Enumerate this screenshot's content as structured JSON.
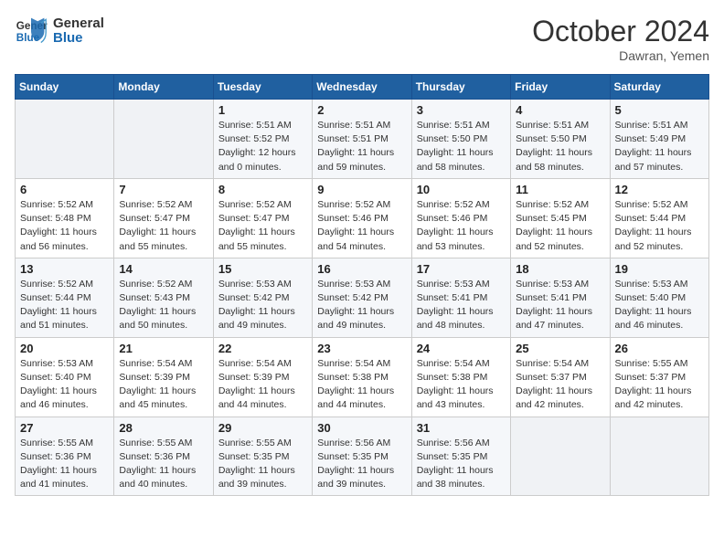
{
  "logo": {
    "line1": "General",
    "line2": "Blue"
  },
  "header": {
    "month": "October 2024",
    "location": "Dawran, Yemen"
  },
  "days_of_week": [
    "Sunday",
    "Monday",
    "Tuesday",
    "Wednesday",
    "Thursday",
    "Friday",
    "Saturday"
  ],
  "weeks": [
    [
      {
        "day": "",
        "detail": ""
      },
      {
        "day": "",
        "detail": ""
      },
      {
        "day": "1",
        "detail": "Sunrise: 5:51 AM\nSunset: 5:52 PM\nDaylight: 12 hours\nand 0 minutes."
      },
      {
        "day": "2",
        "detail": "Sunrise: 5:51 AM\nSunset: 5:51 PM\nDaylight: 11 hours\nand 59 minutes."
      },
      {
        "day": "3",
        "detail": "Sunrise: 5:51 AM\nSunset: 5:50 PM\nDaylight: 11 hours\nand 58 minutes."
      },
      {
        "day": "4",
        "detail": "Sunrise: 5:51 AM\nSunset: 5:50 PM\nDaylight: 11 hours\nand 58 minutes."
      },
      {
        "day": "5",
        "detail": "Sunrise: 5:51 AM\nSunset: 5:49 PM\nDaylight: 11 hours\nand 57 minutes."
      }
    ],
    [
      {
        "day": "6",
        "detail": "Sunrise: 5:52 AM\nSunset: 5:48 PM\nDaylight: 11 hours\nand 56 minutes."
      },
      {
        "day": "7",
        "detail": "Sunrise: 5:52 AM\nSunset: 5:47 PM\nDaylight: 11 hours\nand 55 minutes."
      },
      {
        "day": "8",
        "detail": "Sunrise: 5:52 AM\nSunset: 5:47 PM\nDaylight: 11 hours\nand 55 minutes."
      },
      {
        "day": "9",
        "detail": "Sunrise: 5:52 AM\nSunset: 5:46 PM\nDaylight: 11 hours\nand 54 minutes."
      },
      {
        "day": "10",
        "detail": "Sunrise: 5:52 AM\nSunset: 5:46 PM\nDaylight: 11 hours\nand 53 minutes."
      },
      {
        "day": "11",
        "detail": "Sunrise: 5:52 AM\nSunset: 5:45 PM\nDaylight: 11 hours\nand 52 minutes."
      },
      {
        "day": "12",
        "detail": "Sunrise: 5:52 AM\nSunset: 5:44 PM\nDaylight: 11 hours\nand 52 minutes."
      }
    ],
    [
      {
        "day": "13",
        "detail": "Sunrise: 5:52 AM\nSunset: 5:44 PM\nDaylight: 11 hours\nand 51 minutes."
      },
      {
        "day": "14",
        "detail": "Sunrise: 5:52 AM\nSunset: 5:43 PM\nDaylight: 11 hours\nand 50 minutes."
      },
      {
        "day": "15",
        "detail": "Sunrise: 5:53 AM\nSunset: 5:42 PM\nDaylight: 11 hours\nand 49 minutes."
      },
      {
        "day": "16",
        "detail": "Sunrise: 5:53 AM\nSunset: 5:42 PM\nDaylight: 11 hours\nand 49 minutes."
      },
      {
        "day": "17",
        "detail": "Sunrise: 5:53 AM\nSunset: 5:41 PM\nDaylight: 11 hours\nand 48 minutes."
      },
      {
        "day": "18",
        "detail": "Sunrise: 5:53 AM\nSunset: 5:41 PM\nDaylight: 11 hours\nand 47 minutes."
      },
      {
        "day": "19",
        "detail": "Sunrise: 5:53 AM\nSunset: 5:40 PM\nDaylight: 11 hours\nand 46 minutes."
      }
    ],
    [
      {
        "day": "20",
        "detail": "Sunrise: 5:53 AM\nSunset: 5:40 PM\nDaylight: 11 hours\nand 46 minutes."
      },
      {
        "day": "21",
        "detail": "Sunrise: 5:54 AM\nSunset: 5:39 PM\nDaylight: 11 hours\nand 45 minutes."
      },
      {
        "day": "22",
        "detail": "Sunrise: 5:54 AM\nSunset: 5:39 PM\nDaylight: 11 hours\nand 44 minutes."
      },
      {
        "day": "23",
        "detail": "Sunrise: 5:54 AM\nSunset: 5:38 PM\nDaylight: 11 hours\nand 44 minutes."
      },
      {
        "day": "24",
        "detail": "Sunrise: 5:54 AM\nSunset: 5:38 PM\nDaylight: 11 hours\nand 43 minutes."
      },
      {
        "day": "25",
        "detail": "Sunrise: 5:54 AM\nSunset: 5:37 PM\nDaylight: 11 hours\nand 42 minutes."
      },
      {
        "day": "26",
        "detail": "Sunrise: 5:55 AM\nSunset: 5:37 PM\nDaylight: 11 hours\nand 42 minutes."
      }
    ],
    [
      {
        "day": "27",
        "detail": "Sunrise: 5:55 AM\nSunset: 5:36 PM\nDaylight: 11 hours\nand 41 minutes."
      },
      {
        "day": "28",
        "detail": "Sunrise: 5:55 AM\nSunset: 5:36 PM\nDaylight: 11 hours\nand 40 minutes."
      },
      {
        "day": "29",
        "detail": "Sunrise: 5:55 AM\nSunset: 5:35 PM\nDaylight: 11 hours\nand 39 minutes."
      },
      {
        "day": "30",
        "detail": "Sunrise: 5:56 AM\nSunset: 5:35 PM\nDaylight: 11 hours\nand 39 minutes."
      },
      {
        "day": "31",
        "detail": "Sunrise: 5:56 AM\nSunset: 5:35 PM\nDaylight: 11 hours\nand 38 minutes."
      },
      {
        "day": "",
        "detail": ""
      },
      {
        "day": "",
        "detail": ""
      }
    ]
  ]
}
